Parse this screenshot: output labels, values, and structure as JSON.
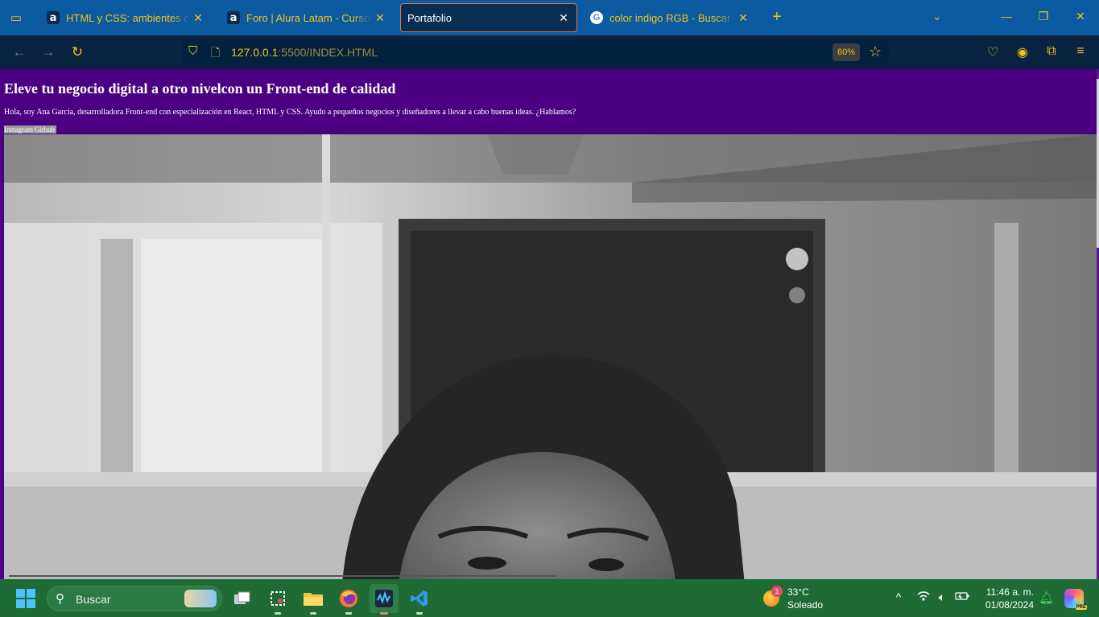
{
  "browser": {
    "tabs": [
      {
        "title": "HTML y CSS: ambientes de des",
        "favicon": "alura-icon",
        "active": false
      },
      {
        "title": "Foro | Alura Latam - Cursos onl",
        "favicon": "alura-icon",
        "active": false
      },
      {
        "title": "Portafolio",
        "favicon": "",
        "active": true
      },
      {
        "title": "color indigo RGB - Buscar con G",
        "favicon": "google-icon",
        "active": false
      }
    ],
    "url_host": "127.0.0.1",
    "url_rest": ":5500/INDEX.HTML",
    "zoom": "60%",
    "accent_color": "#f0c419"
  },
  "page": {
    "title": "Eleve tu negocio digital a otro nivelcon un Front-end de calidad",
    "description": "Hola, soy Ana García, desarrolladora Front-end con especialización en React, HTML y CSS. Ayudo a pequeños negocios y diseñadores a llevar a cabo buenas ideas. ¿Hablamos?",
    "links": [
      "Instagram",
      "Github"
    ],
    "background_color": "#4b0082",
    "image": "black-and-white portrait photo of a woman"
  },
  "taskbar": {
    "search_placeholder": "Buscar",
    "weather": {
      "temp": "33°C",
      "condition": "Soleado",
      "badge": "1"
    },
    "clock": {
      "time": "11:46 a. m.",
      "date": "01/08/2024"
    },
    "copilot_badge": "PRE",
    "apps": [
      "task-view-icon",
      "snipping-tool-icon",
      "file-explorer-icon",
      "firefox-icon",
      "audio-app-icon",
      "vscode-icon"
    ]
  }
}
